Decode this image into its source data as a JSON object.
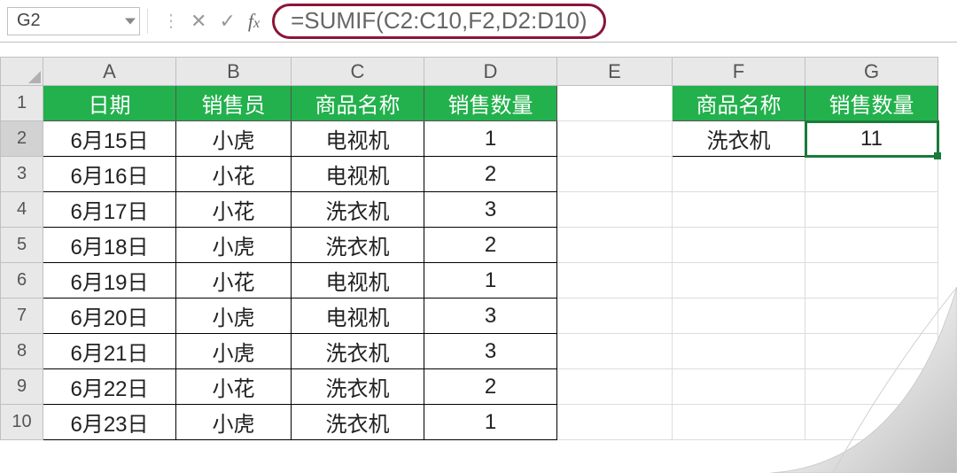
{
  "formula_bar": {
    "cell_ref": "G2",
    "formula": "=SUMIF(C2:C10,F2,D2:D10)"
  },
  "columns": [
    "A",
    "B",
    "C",
    "D",
    "E",
    "F",
    "G"
  ],
  "row_numbers": [
    1,
    2,
    3,
    4,
    5,
    6,
    7,
    8,
    9,
    10
  ],
  "main_table": {
    "headers": [
      "日期",
      "销售员",
      "商品名称",
      "销售数量"
    ],
    "rows": [
      {
        "date": "6月15日",
        "sales": "小虎",
        "product": "电视机",
        "qty": "1"
      },
      {
        "date": "6月16日",
        "sales": "小花",
        "product": "电视机",
        "qty": "2"
      },
      {
        "date": "6月17日",
        "sales": "小花",
        "product": "洗衣机",
        "qty": "3"
      },
      {
        "date": "6月18日",
        "sales": "小虎",
        "product": "洗衣机",
        "qty": "2"
      },
      {
        "date": "6月19日",
        "sales": "小花",
        "product": "电视机",
        "qty": "1"
      },
      {
        "date": "6月20日",
        "sales": "小虎",
        "product": "电视机",
        "qty": "3"
      },
      {
        "date": "6月21日",
        "sales": "小虎",
        "product": "洗衣机",
        "qty": "3"
      },
      {
        "date": "6月22日",
        "sales": "小花",
        "product": "洗衣机",
        "qty": "2"
      },
      {
        "date": "6月23日",
        "sales": "小虎",
        "product": "洗衣机",
        "qty": "1"
      }
    ]
  },
  "summary_table": {
    "headers": [
      "商品名称",
      "销售数量"
    ],
    "row": {
      "product": "洗衣机",
      "qty": "11"
    }
  },
  "colors": {
    "header_green": "#22b14c",
    "highlight_border": "#8a1538",
    "selection": "#1a7a3a"
  }
}
